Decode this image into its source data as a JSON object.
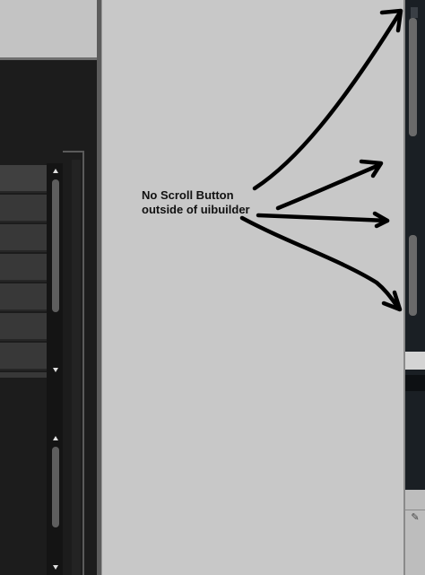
{
  "annotation": {
    "line1": "No Scroll Button",
    "line2": "outside of uibuilder"
  },
  "icons": {
    "scroll_up": "arrow-up-icon",
    "scroll_down": "arrow-down-icon",
    "annotation_arrows": "hand-drawn-arrow-icon",
    "tool": "wrench-icon"
  },
  "colors": {
    "dark_panel": "#1c1c1c",
    "list_row": "#383838",
    "main_background": "#c8c8c8",
    "right_strip": "#1a1f24",
    "annotation_ink": "#000000"
  }
}
